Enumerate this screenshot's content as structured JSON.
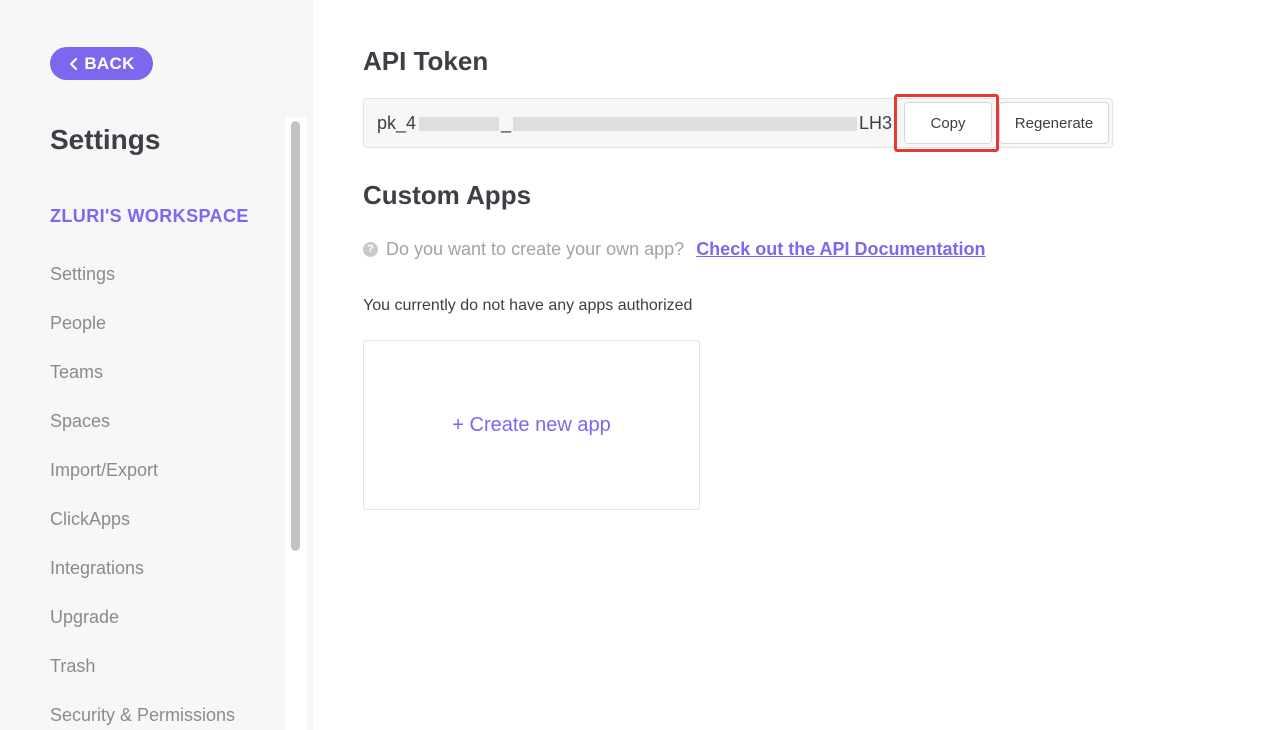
{
  "sidebar": {
    "back_label": "BACK",
    "title": "Settings",
    "workspace": "ZLURI'S WORKSPACE",
    "items": [
      {
        "label": "Settings"
      },
      {
        "label": "People"
      },
      {
        "label": "Teams"
      },
      {
        "label": "Spaces"
      },
      {
        "label": "Import/Export"
      },
      {
        "label": "ClickApps"
      },
      {
        "label": "Integrations"
      },
      {
        "label": "Upgrade"
      },
      {
        "label": "Trash"
      },
      {
        "label": "Security & Permissions"
      }
    ]
  },
  "api_token": {
    "heading": "API Token",
    "token_start": "pk_4",
    "token_sep": "_",
    "token_end": "LH3",
    "copy_label": "Copy",
    "regenerate_label": "Regenerate"
  },
  "custom_apps": {
    "heading": "Custom Apps",
    "help_text": "Do you want to create your own app?",
    "doc_link": "Check out the API Documentation",
    "empty_text": "You currently do not have any apps authorized",
    "create_label": "+ Create new app"
  },
  "colors": {
    "accent": "#7b68ee",
    "highlight": "#e53935",
    "sidebar_bg": "#f7f7f7"
  },
  "icons": {
    "back": "chevron-left-icon",
    "help": "question-circle-icon"
  }
}
